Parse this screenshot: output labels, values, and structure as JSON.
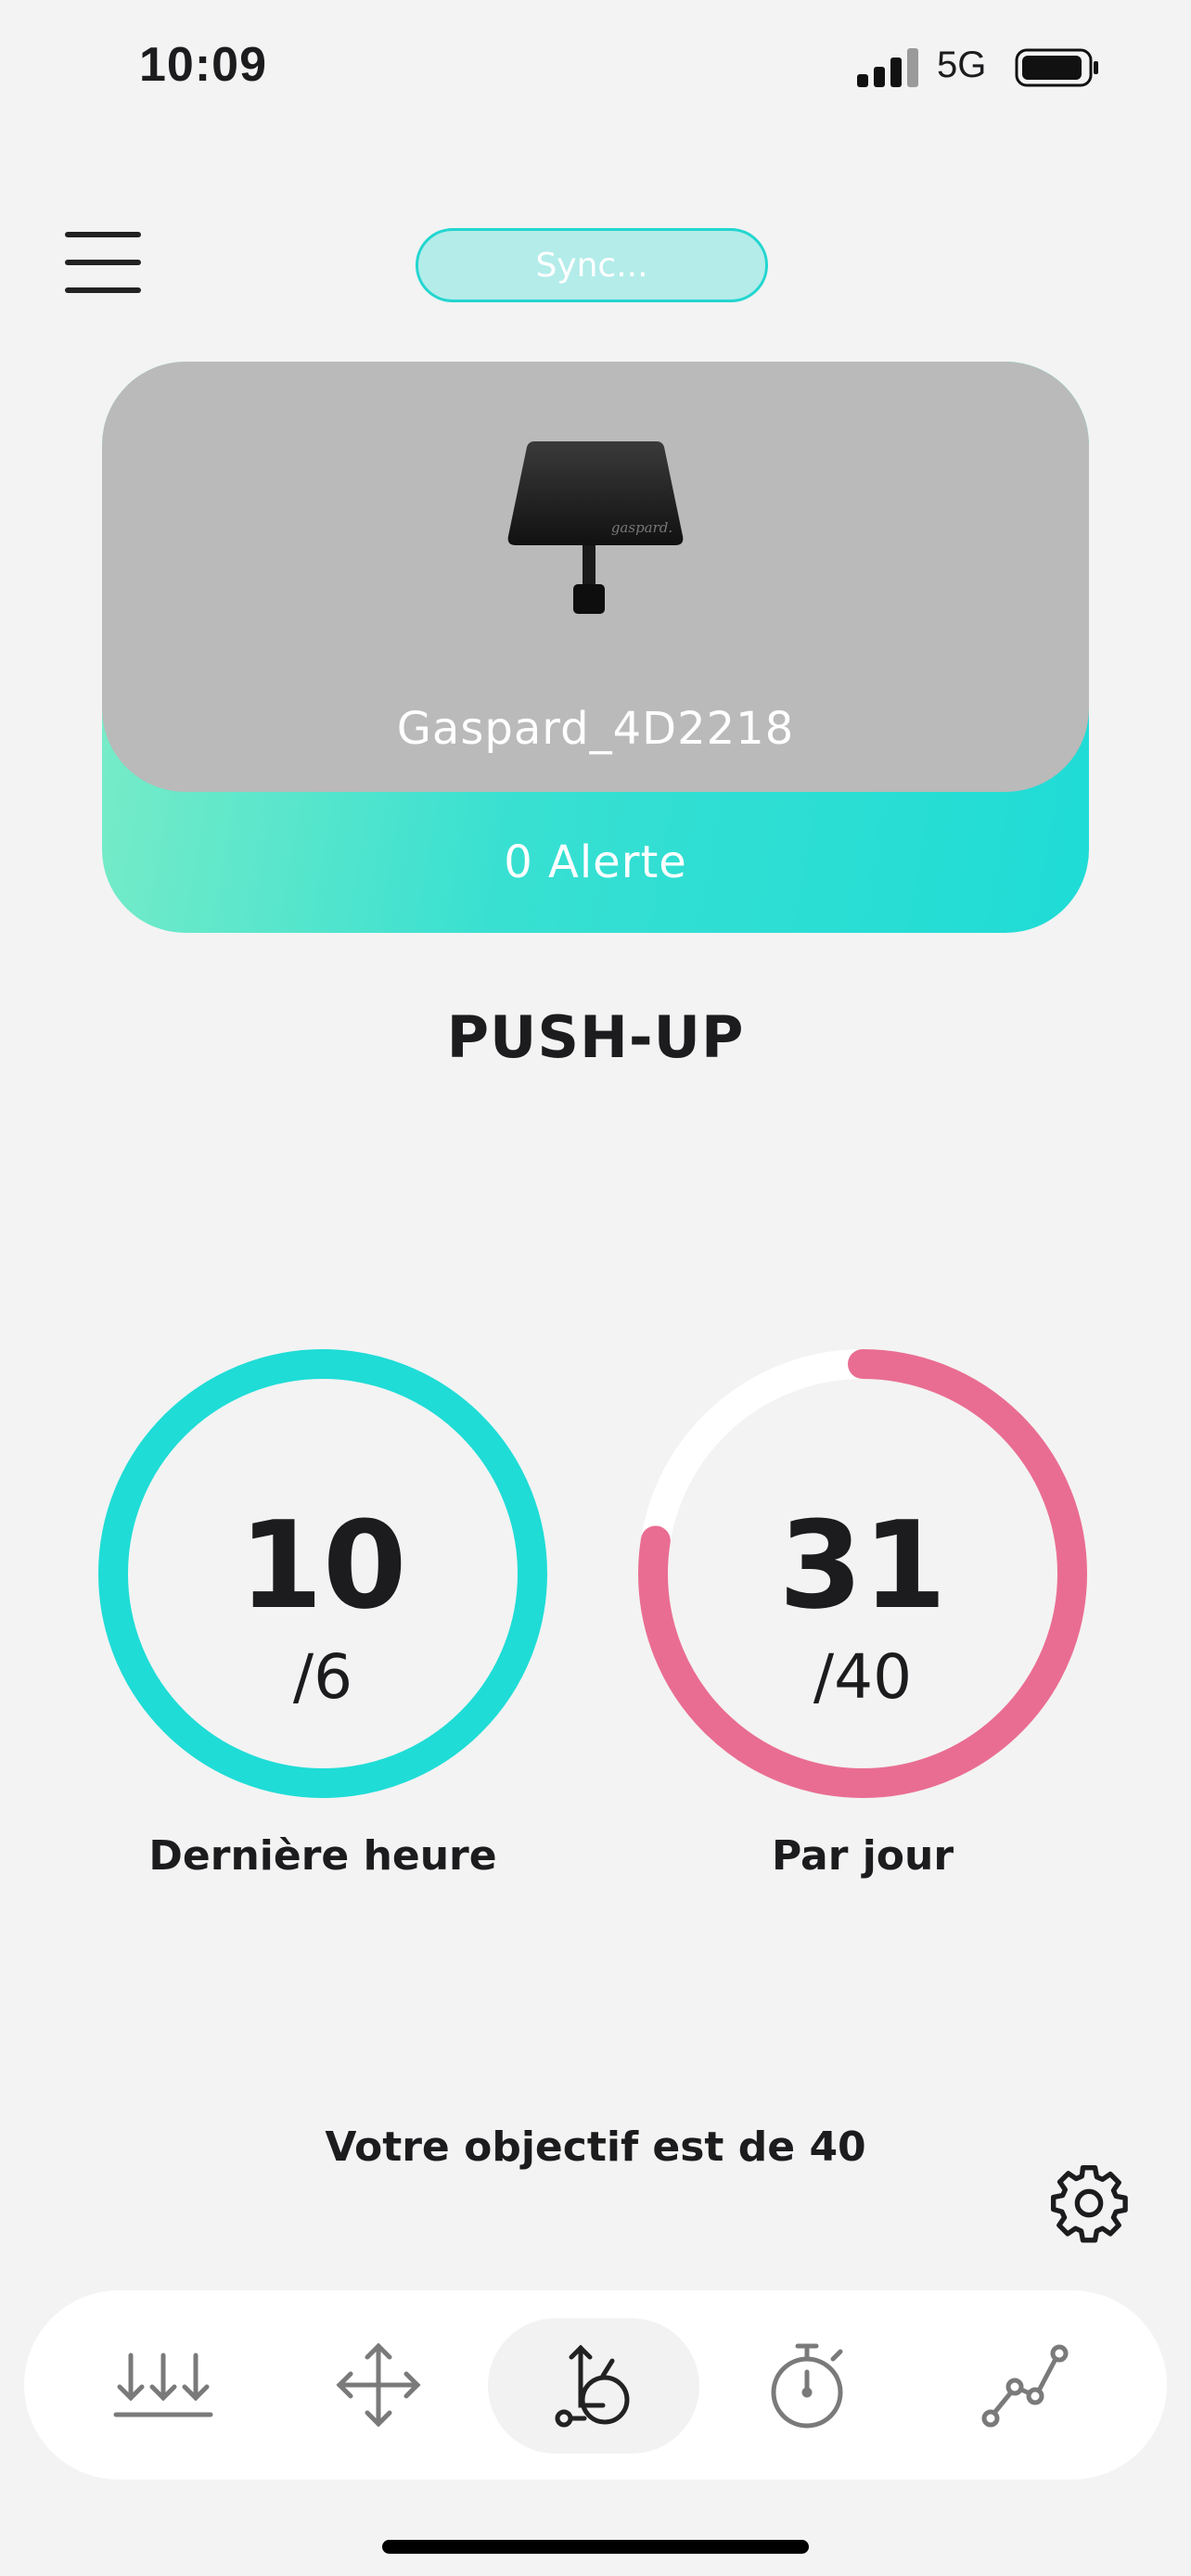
{
  "status_bar": {
    "time": "10:09",
    "network": "5G"
  },
  "header": {
    "sync_label": "Sync..."
  },
  "device": {
    "name": "Gaspard_4D2218",
    "alert": "0 Alerte",
    "logo_text": "gaspard."
  },
  "exercise": {
    "title": "PUSH-UP"
  },
  "stats": [
    {
      "value": "10",
      "target": "/6",
      "label": "Dernière heure",
      "progress": 1.0,
      "color": "#1fdcd6"
    },
    {
      "value": "31",
      "target": "/40",
      "label": "Par jour",
      "progress": 0.775,
      "color": "#e96d92"
    }
  ],
  "goal": {
    "text": "Votre objectif est de 40"
  },
  "icons": {
    "menu": "hamburger-menu-icon",
    "settings": "gear-icon",
    "nav": [
      "pressure-arrows-icon",
      "move-arrows-icon",
      "wheelchair-pushup-icon",
      "stopwatch-icon",
      "chart-line-icon"
    ]
  },
  "nav": {
    "active_index": 2
  },
  "colors": {
    "teal": "#1fdcd6",
    "pink": "#e96d92",
    "card_gray": "#bababa",
    "background": "#f3f3f3"
  }
}
